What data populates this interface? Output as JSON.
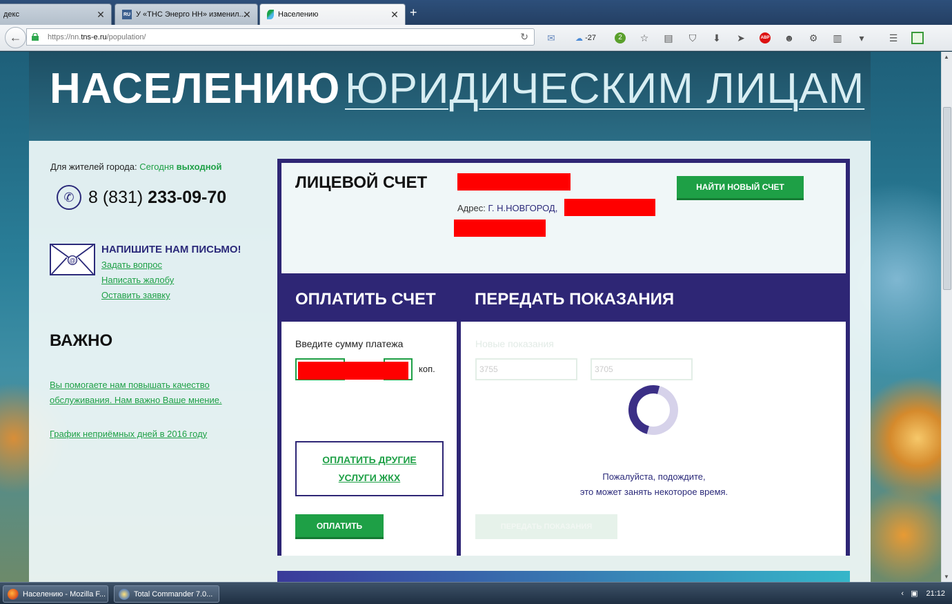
{
  "browser": {
    "tabs": [
      {
        "label": "декс"
      },
      {
        "label": "У «ТНС Энерго НН» изменил...",
        "favicon": "RU"
      },
      {
        "label": "Населению"
      }
    ],
    "url_prefix": "https://nn.",
    "url_host": "tns-e.ru",
    "url_path": "/population/",
    "weather_temp": "-27",
    "badge_count": "2"
  },
  "site": {
    "nav_active": "НАСЕЛЕНИЮ",
    "nav_other": "ЮРИДИЧЕСКИМ ЛИЦАМ"
  },
  "sidebar": {
    "residents_label": "Для жителей города:",
    "today_label": "Сегодня",
    "today_status": "выходной",
    "phone_prefix": "8 (831)",
    "phone_number": "233-09-70",
    "write_title": "НАПИШИТЕ НАМ ПИСЬМО!",
    "links": [
      "Задать вопрос",
      "Написать жалобу",
      "Оставить заявку"
    ],
    "important_title": "ВАЖНО",
    "feedback_line1": "Вы помогаете нам повышать качество",
    "feedback_line2": "обслуживания. Нам важно Ваше мнение.",
    "schedule_link": "График неприёмных дней в 2016 году"
  },
  "account": {
    "label": "ЛИЦЕВОЙ СЧЕТ",
    "address_label": "Адрес:",
    "address_city": "Г. Н.НОВГОРОД,",
    "find_button": "НАЙТИ НОВЫЙ СЧЕТ"
  },
  "pay": {
    "header": "ОПЛАТИТЬ СЧЕТ",
    "amount_label": "Введите сумму платежа",
    "kop_label": "коп.",
    "other_line1": "ОПЛАТИТЬ ДРУГИЕ",
    "other_line2": "УСЛУГИ ЖКХ",
    "pay_button": "ОПЛАТИТЬ"
  },
  "readings": {
    "header": "ПЕРЕДАТЬ ПОКАЗАНИЯ",
    "new_label": "Новые показания",
    "value1": "3755",
    "value2": "3705",
    "wait_line1": "Пожалуйста, подождите,",
    "wait_line2": "это может занять некоторое время.",
    "submit_button": "ПЕРЕДАТЬ ПОКАЗАНИЯ"
  },
  "taskbar": {
    "tasks": [
      "Населению - Mozilla F...",
      "Total Commander 7.0..."
    ],
    "clock": "21:12"
  }
}
